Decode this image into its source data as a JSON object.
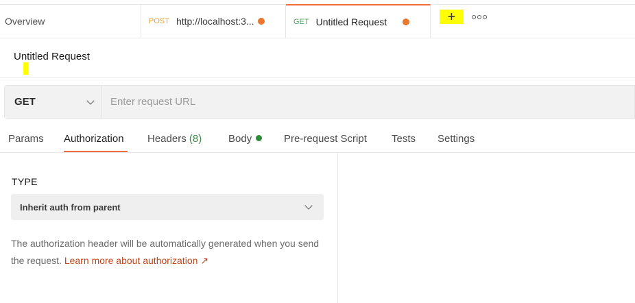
{
  "tabs": {
    "overview_label": "Overview",
    "post_tab": {
      "method": "POST",
      "title": "http://localhost:3..."
    },
    "get_tab": {
      "method": "GET",
      "title": "Untitled Request"
    },
    "new_tab_symbol": "+"
  },
  "request": {
    "title": "Untitled Request",
    "method": "GET",
    "url_placeholder": "Enter request URL"
  },
  "subtabs": {
    "params": "Params",
    "authorization": "Authorization",
    "headers": "Headers",
    "headers_count": "(8)",
    "body": "Body",
    "prerequest": "Pre-request Script",
    "tests": "Tests",
    "settings": "Settings"
  },
  "auth": {
    "type_label": "TYPE",
    "selected_type": "Inherit auth from parent",
    "description": "The authorization header will be automatically generated when you send the request.",
    "learn_more": "Learn more about authorization ↗"
  },
  "colors": {
    "accent": "#f26b3a",
    "unsaved_dot": "#e8762c",
    "post_method": "#e8a33b",
    "get_method": "#4ca560",
    "highlight": "#ffff00",
    "link": "#c0461a"
  },
  "icons": {
    "new_tab": "plus-icon",
    "more": "more-options-icon",
    "method_dropdown": "chevron-down-icon",
    "auth_dropdown": "chevron-down-icon",
    "body_status": "green-dot-icon"
  }
}
